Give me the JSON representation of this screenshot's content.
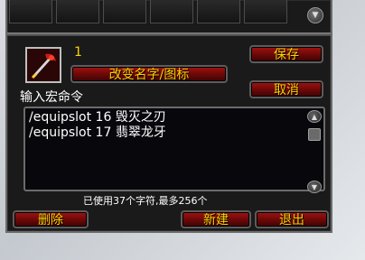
{
  "macro": {
    "index": "1",
    "rename_button": "改变名字/图标",
    "command_label": "输入宏命令",
    "lines": [
      "/equipslot 16 毁灭之刃",
      "/equipslot 17 翡翠龙牙"
    ],
    "char_count": "已使用37个字符,最多256个"
  },
  "buttons": {
    "save": "保存",
    "cancel": "取消",
    "delete": "删除",
    "new": "新建",
    "exit": "退出"
  },
  "icons": {
    "macro_icon": "red-sword-icon",
    "scroll_up": "arrow-up-icon",
    "scroll_down": "arrow-down-icon",
    "slot_scroll": "arrow-down-icon"
  },
  "colors": {
    "button_text": "#ffd200",
    "button_bg": "#8b0c0c",
    "frame": "#1a1a1a"
  }
}
